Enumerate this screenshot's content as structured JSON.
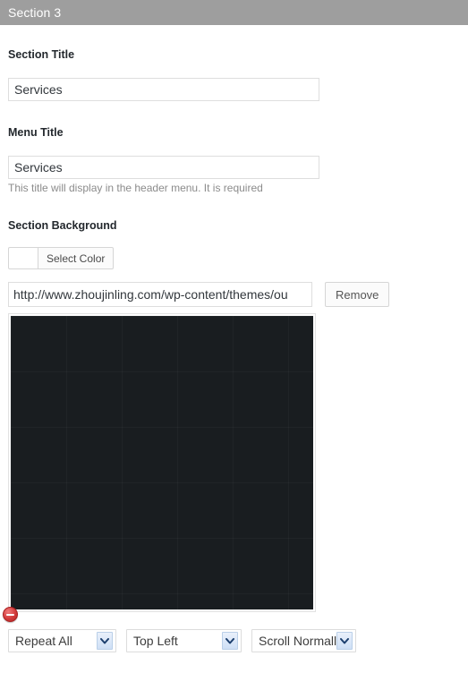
{
  "header": {
    "title": "Section 3"
  },
  "fields": {
    "section_title": {
      "label": "Section Title",
      "value": "Services"
    },
    "menu_title": {
      "label": "Menu Title",
      "value": "Services",
      "help": "This title will display in the header menu. It is required"
    },
    "section_background": {
      "label": "Section Background",
      "color_picker": {
        "button_label": "Select Color",
        "swatch_color": "#ffffff"
      },
      "image_url": "http://www.zhoujinling.com/wp-content/themes/ou",
      "remove_button_label": "Remove",
      "preview": {
        "image_color": "#191d20",
        "remove_icon": "minus-circle-icon"
      },
      "repeat": {
        "selected": "Repeat All"
      },
      "position": {
        "selected": "Top Left"
      },
      "attachment": {
        "selected": "Scroll Normally"
      }
    }
  },
  "colors": {
    "header_bar": "#9e9e9e",
    "header_text": "#ffffff",
    "label_text": "#23282d",
    "help_text": "#8b8b8b",
    "remove_badge": "#d33a3a"
  }
}
